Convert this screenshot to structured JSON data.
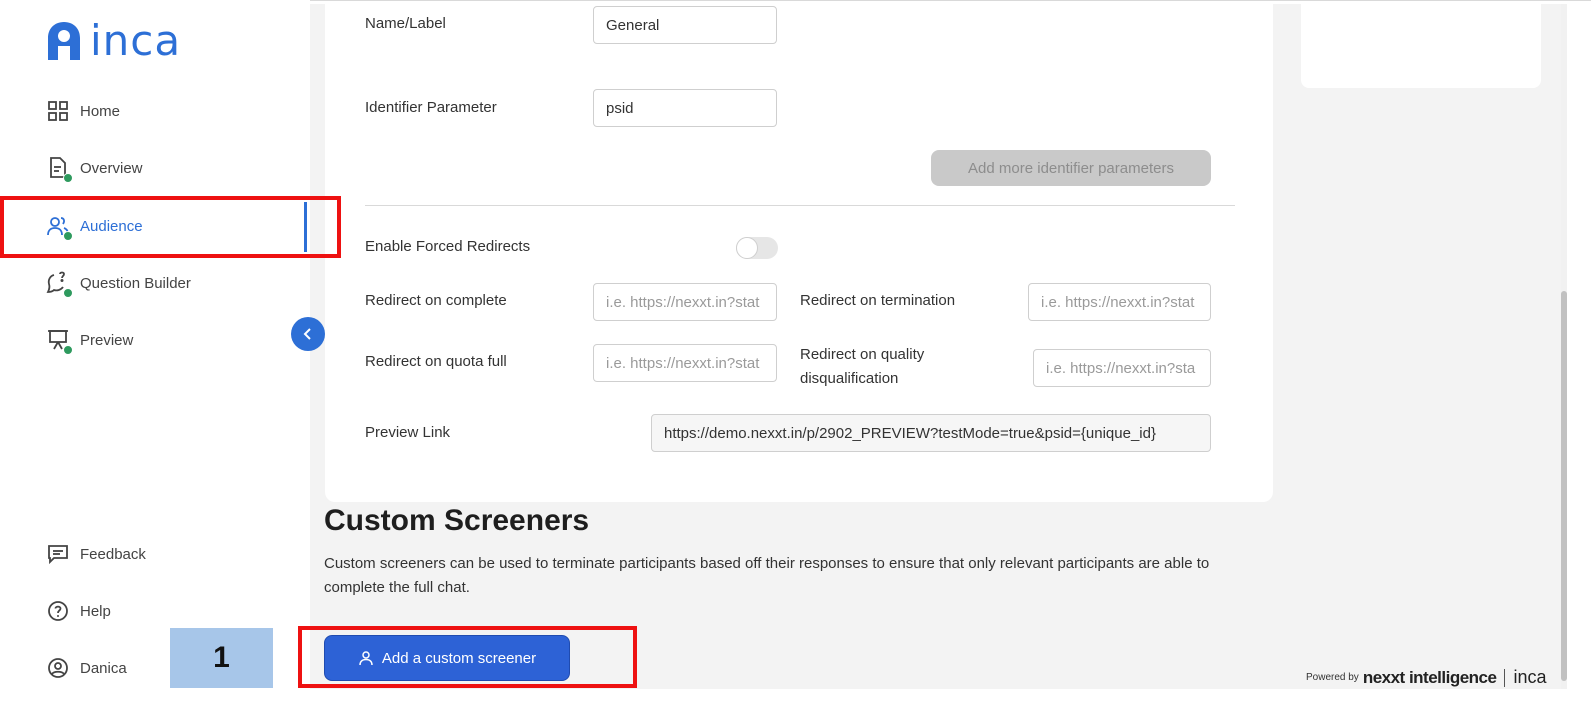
{
  "brand": {
    "logo_text": "inca",
    "accent": "#2d6fd6"
  },
  "sidebar": {
    "items": [
      {
        "label": "Home",
        "icon": "grid-icon"
      },
      {
        "label": "Overview",
        "icon": "document-check-icon"
      },
      {
        "label": "Audience",
        "icon": "users-icon",
        "active": true
      },
      {
        "label": "Question Builder",
        "icon": "chat-question-icon"
      },
      {
        "label": "Preview",
        "icon": "presentation-icon"
      }
    ],
    "bottom": [
      {
        "label": "Feedback",
        "icon": "feedback-icon"
      },
      {
        "label": "Help",
        "icon": "help-icon"
      },
      {
        "label": "Danica",
        "icon": "user-circle-icon"
      }
    ]
  },
  "form": {
    "name_label": "Name/Label",
    "name_value": "General",
    "identifier_label": "Identifier Parameter",
    "identifier_value": "psid",
    "add_identifier_button": "Add more identifier parameters",
    "forced_redirects_label": "Enable Forced Redirects",
    "forced_redirects_enabled": false,
    "redirect_complete_label": "Redirect on complete",
    "redirect_complete_placeholder": "i.e. https://nexxt.in?stat",
    "redirect_termination_label": "Redirect on termination",
    "redirect_termination_placeholder": "i.e. https://nexxt.in?stat",
    "redirect_quota_label": "Redirect on quota full",
    "redirect_quota_placeholder": "i.e. https://nexxt.in?stat",
    "redirect_quality_label_line1": "Redirect on quality",
    "redirect_quality_label_line2": "disqualification",
    "redirect_quality_placeholder": "i.e. https://nexxt.in?sta",
    "preview_link_label": "Preview Link",
    "preview_link_value": "https://demo.nexxt.in/p/2902_PREVIEW?testMode=true&psid={unique_id}"
  },
  "screeners": {
    "title": "Custom Screeners",
    "description": "Custom screeners can be used to terminate participants based off their responses to ensure that only relevant participants are able to complete the full chat.",
    "add_button": "Add a custom screener"
  },
  "annotation": {
    "step_number": "1",
    "highlight_color": "#ee1111"
  },
  "footer": {
    "powered_by": "Powered by",
    "brand": "nexxt intelligence",
    "product": "inca"
  }
}
